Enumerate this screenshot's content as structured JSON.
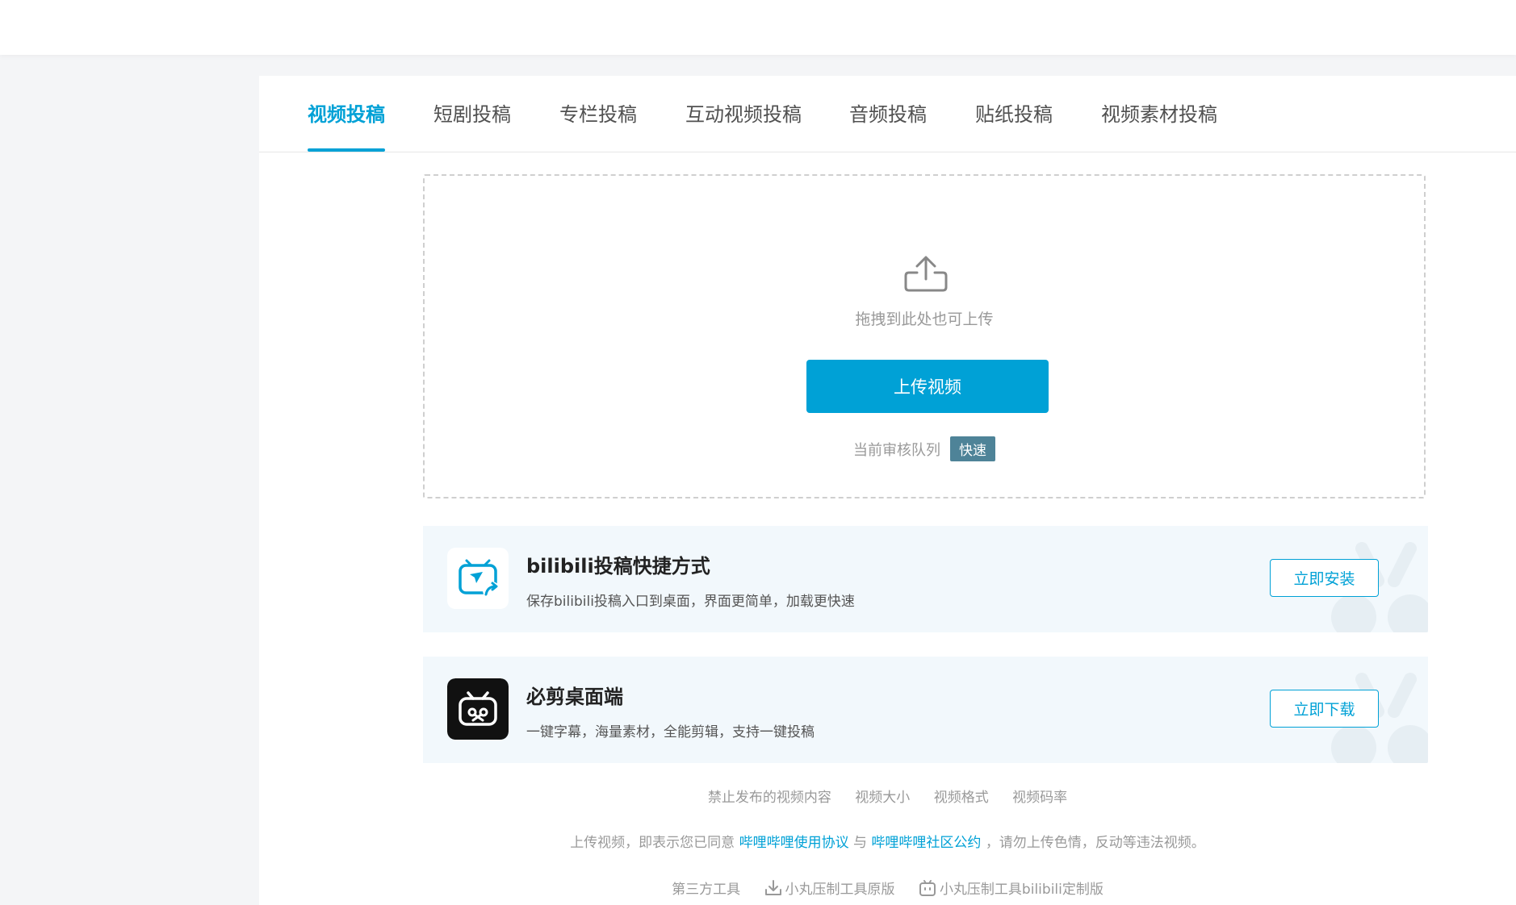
{
  "tabs": [
    {
      "label": "视频投稿",
      "active": true
    },
    {
      "label": "短剧投稿"
    },
    {
      "label": "专栏投稿"
    },
    {
      "label": "互动视频投稿"
    },
    {
      "label": "音频投稿"
    },
    {
      "label": "贴纸投稿"
    },
    {
      "label": "视频素材投稿"
    }
  ],
  "upload": {
    "icon": "upload-icon",
    "hint": "拖拽到此处也可上传",
    "button_label": "上传视频",
    "queue_label": "当前审核队列",
    "queue_status": "快速"
  },
  "cards": [
    {
      "icon": "bilibili-shortcut-icon",
      "title": "bilibili投稿快捷方式",
      "desc": "保存bilibili投稿入口到桌面，界面更简单，加载更快速",
      "action": "立即安装"
    },
    {
      "icon": "bijian-app-icon",
      "title": "必剪桌面端",
      "desc": "一键字幕，海量素材，全能剪辑，支持一键投稿",
      "action": "立即下载"
    }
  ],
  "info_links": [
    "禁止发布的视频内容",
    "视频大小",
    "视频格式",
    "视频码率"
  ],
  "agreement": {
    "prefix": "上传视频，即表示您已同意",
    "link1": "哔哩哔哩使用协议",
    "conj": "与",
    "link2": "哔哩哔哩社区公约",
    "suffix": "，请勿上传色情，反动等违法视频。"
  },
  "tools": {
    "label": "第三方工具",
    "item1": "小丸压制工具原版",
    "item2": "小丸压制工具bilibili定制版"
  },
  "colors": {
    "accent": "#00a1d6",
    "queue_badge": "#4e8398",
    "card_bg": "#f2f8fc"
  }
}
